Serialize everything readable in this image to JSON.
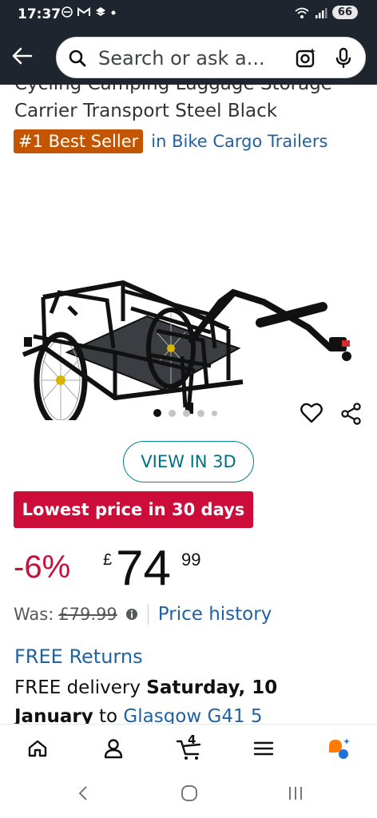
{
  "status_bar": {
    "time": "17:37",
    "battery": "66"
  },
  "search": {
    "placeholder": "Search or ask a..."
  },
  "product": {
    "title_line_1": "Cycling Camping Luggage Storage",
    "title_line_2": "Carrier Transport Steel Black",
    "best_seller_badge": "#1 Best Seller",
    "best_seller_category": "in Bike Cargo Trailers",
    "view_3d_label": "VIEW IN 3D",
    "deal_badge": "Lowest price in 30 days",
    "image_count": 5,
    "active_image": 1
  },
  "price": {
    "discount": "-6%",
    "currency": "£",
    "whole": "74",
    "fraction": "99",
    "was_label": "Was:",
    "was_price": "£79.99",
    "price_history_label": "Price history"
  },
  "delivery": {
    "free_returns": "FREE Returns",
    "line_1_prefix": "FREE delivery ",
    "line_1_date": "Saturday, 10",
    "line_2_date": "January",
    "line_2_to": " to ",
    "line_2_location": "Glasgow G41 5"
  },
  "bottom_nav": {
    "cart_count": "4",
    "items": [
      "home-icon",
      "account-icon",
      "cart-icon",
      "menu-icon",
      "rufus-icon"
    ]
  },
  "colors": {
    "header_bg": "#1f252e",
    "deal_red": "#cc0c39",
    "best_seller_orange": "#c45500",
    "link_blue": "#2162a1",
    "teal": "#007185"
  }
}
